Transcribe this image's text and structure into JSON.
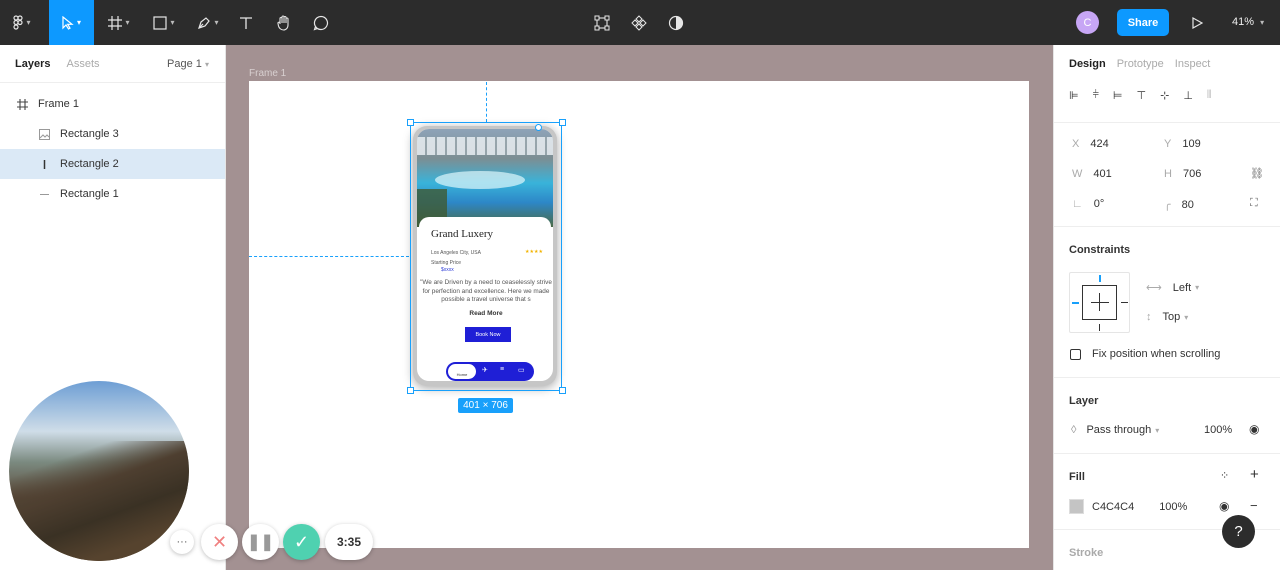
{
  "toolbar": {
    "tools": [
      "main-menu",
      "move-tool",
      "frame-tool",
      "shape-tool",
      "pen-tool",
      "text-tool",
      "hand-tool",
      "comment-tool"
    ],
    "avatar_initial": "C",
    "share_label": "Share",
    "zoom": "41%"
  },
  "left_panel": {
    "tabs": [
      "Layers",
      "Assets"
    ],
    "page": "Page 1",
    "layers": [
      {
        "name": "Frame 1",
        "icon": "frame-icon"
      },
      {
        "name": "Rectangle 3",
        "icon": "image-icon"
      },
      {
        "name": "Rectangle 2",
        "icon": "rectangle-line-icon",
        "selected": true
      },
      {
        "name": "Rectangle 1",
        "icon": "line-icon"
      }
    ]
  },
  "canvas": {
    "frame_label": "Frame 1",
    "dimensions": "401 × 706",
    "mockup": {
      "hotel_name": "Grand Luxery",
      "location": "Los Angeles City, USA",
      "stars": "★★★★",
      "starting_price_label": "Starting Price",
      "price": "$xxxx",
      "description": "\"We are Driven by a need to ceaselessly strive for perfection and excellence. Here we made possible a travel universe that s",
      "read_more": "Read More",
      "book_now": "Book Now",
      "nav_home": "Home"
    }
  },
  "right_panel": {
    "tabs": [
      "Design",
      "Prototype",
      "Inspect"
    ],
    "x": "424",
    "y": "109",
    "w": "401",
    "h": "706",
    "rotation": "0°",
    "radius": "80",
    "constraints_title": "Constraints",
    "constraint_h": "Left",
    "constraint_v": "Top",
    "fix_position": "Fix position when scrolling",
    "layer_title": "Layer",
    "blend": "Pass through",
    "layer_opacity": "100%",
    "fill_title": "Fill",
    "fill_color": "C4C4C4",
    "fill_opacity": "100%",
    "stroke_title": "Stroke",
    "fill_swatch": "#c4c4c4"
  },
  "recorder": {
    "time": "3:35"
  },
  "help_label": "?"
}
